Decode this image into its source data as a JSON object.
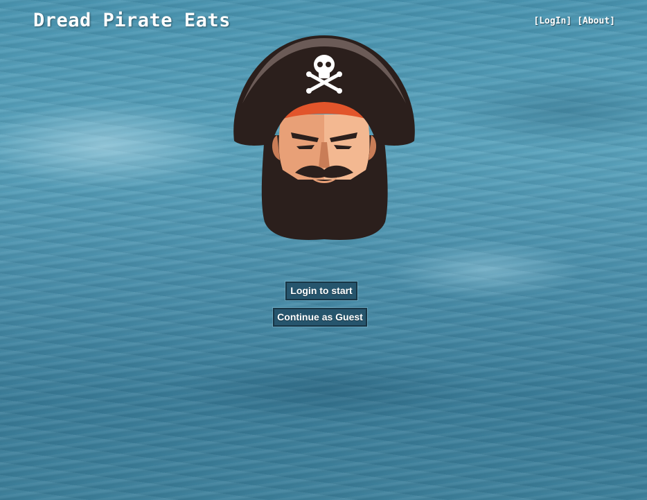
{
  "site": {
    "title": "Dread Pirate Eats"
  },
  "nav": {
    "login": "[LogIn]",
    "about": "[About]"
  },
  "hero": {
    "mascot_icon": "pirate-captain-mascot"
  },
  "actions": {
    "login_label": "Login to start",
    "guest_label": "Continue as Guest"
  },
  "colors": {
    "button_bg": "#26556d",
    "hat": "#2b1f1c",
    "bandana": "#e2552b",
    "skin": "#e8a077",
    "background": "#4a8fab"
  }
}
